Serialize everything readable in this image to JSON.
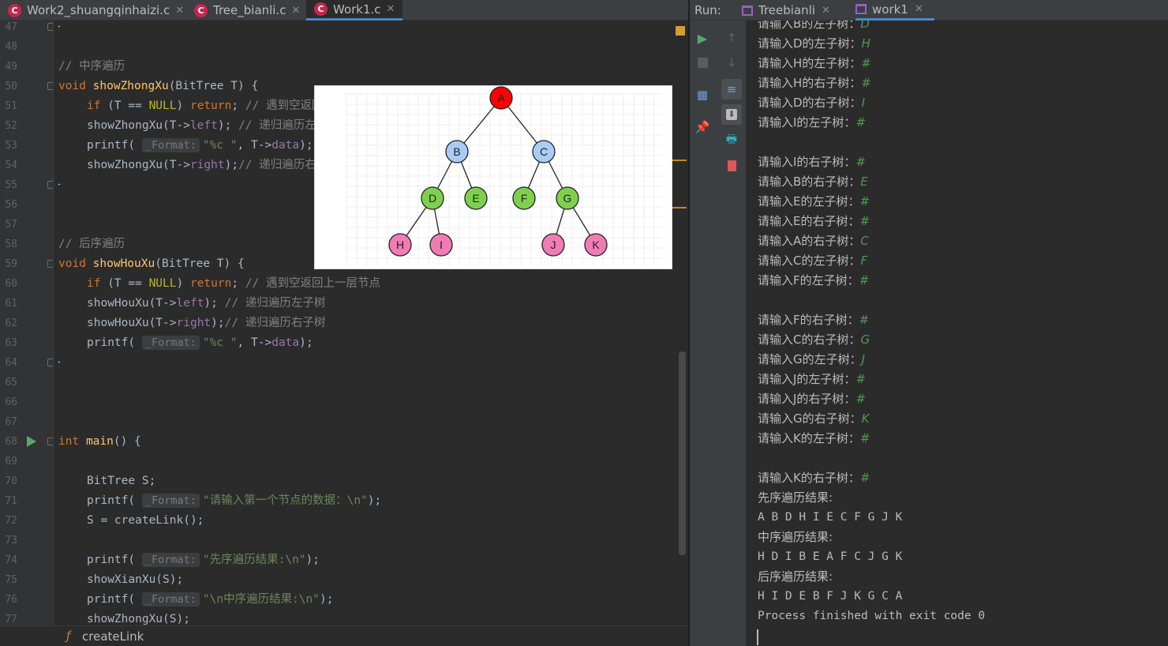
{
  "editor": {
    "tabs": [
      {
        "label": "Work2_shuangqinhaizi.c",
        "active": false
      },
      {
        "label": "Tree_bianli.c",
        "active": false
      },
      {
        "label": "Work1.c",
        "active": true
      }
    ],
    "line_numbers": [
      "47",
      "48",
      "49",
      "50",
      "51",
      "52",
      "53",
      "54",
      "55",
      "56",
      "57",
      "58",
      "59",
      "60",
      "61",
      "62",
      "63",
      "64",
      "65",
      "66",
      "67",
      "68",
      "69",
      "70",
      "71",
      "72",
      "73",
      "74",
      "75",
      "76",
      "77"
    ],
    "code": {
      "l47": "}",
      "l49": "// 中序遍历",
      "l50_kw": "void",
      "l50_fn": "showZhongXu",
      "l50_rest": "(BitTree T) {",
      "l51_kw": "if",
      "l51_a": " (T == ",
      "l51_null": "NULL",
      "l51_b": ") ",
      "l51_ret": "return",
      "l51_c": "; ",
      "l51_cm": "// 遇到空返回上一层节点",
      "l52_a": "showZhongXu(T->",
      "l52_f": "left",
      "l52_b": "); ",
      "l52_cm": "// 递归遍历左子树",
      "l53_a": "printf( ",
      "l53_hint": "_Format:",
      "l53_str": "\"%c \"",
      "l53_b": ", T->",
      "l53_f": "data",
      "l53_c": ");",
      "l54_a": "showZhongXu(T->",
      "l54_f": "right",
      "l54_b": ");",
      "l54_cm": "// 递归遍历右子树",
      "l55": "}",
      "l58": "// 后序遍历",
      "l59_kw": "void",
      "l59_fn": "showHouXu",
      "l59_rest": "(BitTree T) {",
      "l60_kw": "if",
      "l60_a": " (T == ",
      "l60_null": "NULL",
      "l60_b": ") ",
      "l60_ret": "return",
      "l60_c": "; ",
      "l60_cm": "// 遇到空返回上一层节点",
      "l61_a": "showHouXu(T->",
      "l61_f": "left",
      "l61_b": "); ",
      "l61_cm": "// 递归遍历左子树",
      "l62_a": "showHouXu(T->",
      "l62_f": "right",
      "l62_b": ");",
      "l62_cm": "// 递归遍历右子树",
      "l63_a": "printf( ",
      "l63_hint": "_Format:",
      "l63_str": "\"%c \"",
      "l63_b": ", T->",
      "l63_f": "data",
      "l63_c": ");",
      "l64": "}",
      "l68_kw": "int",
      "l68_fn": "main",
      "l68_rest": "() {",
      "l70": "BitTree S;",
      "l71_a": "printf( ",
      "l71_hint": "_Format:",
      "l71_str": "\"请输入第一个节点的数据：\\n\"",
      "l71_c": ");",
      "l72": "S = createLink();",
      "l74_a": "printf( ",
      "l74_hint": "_Format:",
      "l74_str": "\"先序遍历结果:\\n\"",
      "l74_c": ");",
      "l75": "showXianXu(S);",
      "l76_a": "printf( ",
      "l76_hint": "_Format:",
      "l76_str": "\"\\n中序遍历结果:\\n\"",
      "l76_c": ");",
      "l77": "showZhongXu(S);"
    },
    "status_function": "createLink",
    "status_icon": "function-icon"
  },
  "tree_image": {
    "nodes": [
      {
        "label": "A",
        "color": "#ff0000"
      },
      {
        "label": "B",
        "color": "#a9ccf5"
      },
      {
        "label": "C",
        "color": "#a9ccf5"
      },
      {
        "label": "D",
        "color": "#7ed14f"
      },
      {
        "label": "E",
        "color": "#7ed14f"
      },
      {
        "label": "F",
        "color": "#7ed14f"
      },
      {
        "label": "G",
        "color": "#7ed14f"
      },
      {
        "label": "H",
        "color": "#f07bb5"
      },
      {
        "label": "I",
        "color": "#f07bb5"
      },
      {
        "label": "J",
        "color": "#f07bb5"
      },
      {
        "label": "K",
        "color": "#f07bb5"
      }
    ],
    "edges": [
      [
        "A",
        "B"
      ],
      [
        "A",
        "C"
      ],
      [
        "B",
        "D"
      ],
      [
        "B",
        "E"
      ],
      [
        "C",
        "F"
      ],
      [
        "C",
        "G"
      ],
      [
        "D",
        "H"
      ],
      [
        "D",
        "I"
      ],
      [
        "G",
        "J"
      ],
      [
        "G",
        "K"
      ]
    ]
  },
  "run_panel": {
    "label": "Run:",
    "tabs": [
      {
        "label": "Treebianli",
        "active": false
      },
      {
        "label": "work1",
        "active": true
      }
    ],
    "tools": [
      "run-icon",
      "stop-icon",
      "up-arrow-icon",
      "down-arrow-icon",
      "layout-icon",
      "soft-wrap-icon",
      "pin-icon",
      "scroll-to-end-icon",
      "print-icon",
      "trash-icon"
    ],
    "console": [
      {
        "prompt": "请输入B的左子树：",
        "input": "D"
      },
      {
        "prompt": "请输入D的左子树：",
        "input": "H"
      },
      {
        "prompt": "请输入H的左子树：",
        "input": "#"
      },
      {
        "prompt": "请输入H的右子树：",
        "input": "#"
      },
      {
        "prompt": "请输入D的右子树：",
        "input": "I"
      },
      {
        "prompt": "请输入I的左子树：",
        "input": "#"
      },
      {
        "prompt": "",
        "input": ""
      },
      {
        "prompt": "请输入I的右子树：",
        "input": "#"
      },
      {
        "prompt": "请输入B的右子树：",
        "input": "E"
      },
      {
        "prompt": "请输入E的左子树：",
        "input": "#"
      },
      {
        "prompt": "请输入E的右子树：",
        "input": "#"
      },
      {
        "prompt": "请输入A的右子树：",
        "input": "C"
      },
      {
        "prompt": "请输入C的左子树：",
        "input": "F"
      },
      {
        "prompt": "请输入F的左子树：",
        "input": "#"
      },
      {
        "prompt": "",
        "input": ""
      },
      {
        "prompt": "请输入F的右子树：",
        "input": "#"
      },
      {
        "prompt": "请输入C的右子树：",
        "input": "G"
      },
      {
        "prompt": "请输入G的左子树：",
        "input": "J"
      },
      {
        "prompt": "请输入J的左子树：",
        "input": "#"
      },
      {
        "prompt": "请输入J的右子树：",
        "input": "#"
      },
      {
        "prompt": "请输入G的右子树：",
        "input": "K"
      },
      {
        "prompt": "请输入K的左子树：",
        "input": "#"
      },
      {
        "prompt": "",
        "input": ""
      },
      {
        "prompt": "请输入K的右子树：",
        "input": "#"
      },
      {
        "prompt": "先序遍历结果:",
        "input": ""
      },
      {
        "prompt": "A B D H I E C F G J K",
        "input": ""
      },
      {
        "prompt": "中序遍历结果:",
        "input": ""
      },
      {
        "prompt": "H D I B E A F C J G K",
        "input": ""
      },
      {
        "prompt": "后序遍历结果:",
        "input": ""
      },
      {
        "prompt": "H I D E B F J K G C A",
        "input": ""
      },
      {
        "prompt": "Process finished with exit code 0",
        "input": ""
      }
    ]
  }
}
